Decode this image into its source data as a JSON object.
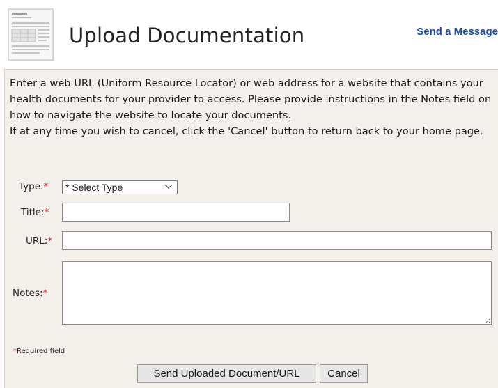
{
  "header": {
    "title": "Upload Documentation",
    "send_message_label": "Send a Message",
    "icon": "document-icon"
  },
  "instructions": {
    "paragraph1": "Enter a web URL (Uniform Resource Locator) or web address for a website that contains your health documents for your provider to access. Please provide instructions in the Notes field on how to navigate the website to locate your documents.",
    "paragraph2": "If at any time you wish to cancel, click the 'Cancel' button to return back to your home page."
  },
  "form": {
    "type_label": "Type:",
    "type_selected": "* Select Type",
    "title_label": "Title:",
    "title_value": "",
    "url_label": "URL:",
    "url_value": "",
    "notes_label": "Notes:",
    "notes_value": "",
    "required_marker": "*",
    "required_note": "Required field"
  },
  "buttons": {
    "send_label": "Send Uploaded Document/URL",
    "cancel_label": "Cancel"
  },
  "colors": {
    "link": "#1b4bb3",
    "required": "#d21a1a",
    "panel_bg": "#f3f0ec"
  }
}
